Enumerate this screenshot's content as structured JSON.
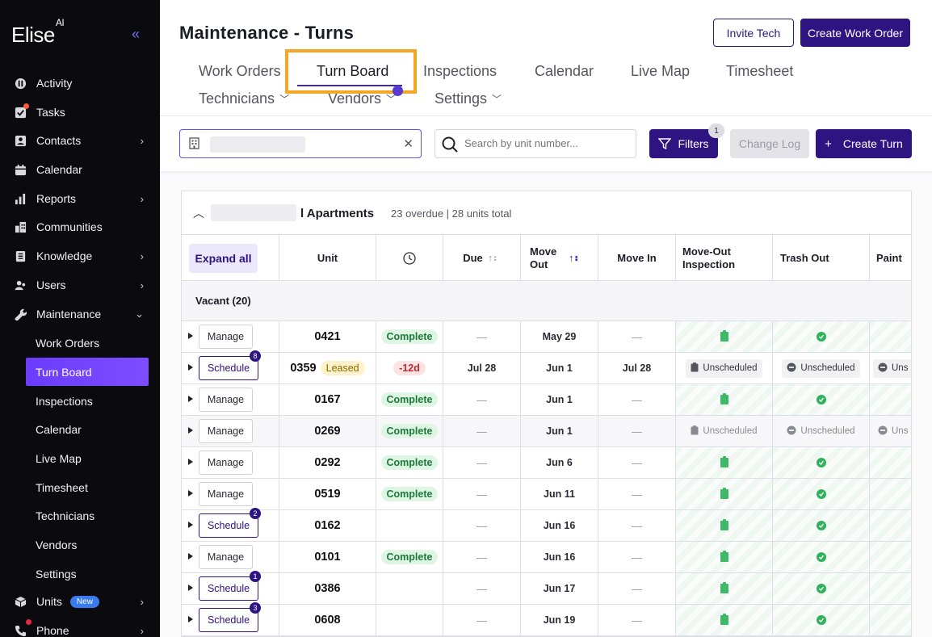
{
  "brand": {
    "name": "Elise",
    "suffix": "AI"
  },
  "sidebar": {
    "items": [
      {
        "label": "Activity",
        "icon": "activity-icon",
        "chevron": false
      },
      {
        "label": "Tasks",
        "icon": "tasks-icon",
        "chevron": false,
        "dot": true
      },
      {
        "label": "Contacts",
        "icon": "contacts-icon",
        "chevron": true
      },
      {
        "label": "Calendar",
        "icon": "calendar-icon",
        "chevron": false
      },
      {
        "label": "Reports",
        "icon": "reports-icon",
        "chevron": true
      },
      {
        "label": "Communities",
        "icon": "communities-icon",
        "chevron": false
      },
      {
        "label": "Knowledge",
        "icon": "knowledge-icon",
        "chevron": true
      },
      {
        "label": "Users",
        "icon": "users-icon",
        "chevron": true
      },
      {
        "label": "Maintenance",
        "icon": "wrench-icon",
        "chevron": "down"
      }
    ],
    "maintenance_sub": [
      "Work Orders",
      "Turn Board",
      "Inspections",
      "Calendar",
      "Live Map",
      "Timesheet",
      "Technicians",
      "Vendors",
      "Settings"
    ],
    "active_sub": "Turn Board",
    "units": {
      "label": "Units",
      "badge": "New"
    },
    "phone": {
      "label": "Phone"
    }
  },
  "header": {
    "title": "Maintenance - Turns",
    "invite_label": "Invite Tech",
    "create_wo_label": "Create Work Order"
  },
  "tabs": {
    "row1": [
      "Work Orders",
      "Turn Board",
      "Inspections",
      "Calendar",
      "Live Map",
      "Timesheet"
    ],
    "row2": [
      "Technicians",
      "Vendors",
      "Settings"
    ],
    "active": "Turn Board"
  },
  "toolbar": {
    "search_placeholder": "Search by unit number...",
    "filters_label": "Filters",
    "filters_count": "1",
    "changelog_label": "Change Log",
    "create_turn_label": "Create Turn"
  },
  "group": {
    "name": "l Apartments",
    "summary": "23 overdue | 28 units total"
  },
  "table": {
    "expand_label": "Expand all",
    "columns": {
      "unit": "Unit",
      "due": "Due",
      "move_out": "Move Out",
      "move_in": "Move In",
      "moveout_insp": "Move-Out Inspection",
      "trash": "Trash Out",
      "paint": "Paint"
    },
    "section": "Vacant (20)",
    "rows": [
      {
        "action": "Manage",
        "unit": "0421",
        "status": "Complete",
        "due": "—",
        "move_out": "May 29",
        "move_in": "—",
        "tasks": "done"
      },
      {
        "action": "Schedule",
        "badge": "8",
        "unit": "0359",
        "leased": "Leased",
        "status": "-12d",
        "due": "Jul 28",
        "move_out": "Jun 1",
        "move_in": "Jul 28",
        "tasks": "unscheduled"
      },
      {
        "action": "Manage",
        "unit": "0167",
        "status": "Complete",
        "due": "—",
        "move_out": "Jun 1",
        "move_in": "—",
        "tasks": "done"
      },
      {
        "action": "Manage",
        "unit": "0269",
        "status": "Complete",
        "due": "—",
        "move_out": "Jun 1",
        "move_in": "—",
        "tasks": "unscheduled-gray"
      },
      {
        "action": "Manage",
        "unit": "0292",
        "status": "Complete",
        "due": "—",
        "move_out": "Jun 6",
        "move_in": "—",
        "tasks": "done"
      },
      {
        "action": "Manage",
        "unit": "0519",
        "status": "Complete",
        "due": "—",
        "move_out": "Jun 11",
        "move_in": "—",
        "tasks": "done"
      },
      {
        "action": "Schedule",
        "badge": "2",
        "unit": "0162",
        "status": "",
        "due": "—",
        "move_out": "Jun 16",
        "move_in": "—",
        "tasks": "done"
      },
      {
        "action": "Manage",
        "unit": "0101",
        "status": "Complete",
        "due": "—",
        "move_out": "Jun 16",
        "move_in": "—",
        "tasks": "done"
      },
      {
        "action": "Schedule",
        "badge": "1",
        "unit": "0386",
        "status": "",
        "due": "—",
        "move_out": "Jun 17",
        "move_in": "—",
        "tasks": "done"
      },
      {
        "action": "Schedule",
        "badge": "3",
        "unit": "0608",
        "status": "",
        "due": "—",
        "move_out": "Jun 19",
        "move_in": "—",
        "tasks": "done"
      }
    ],
    "unscheduled_label": "Unscheduled",
    "paint_cut_label": "Uns"
  },
  "colors": {
    "accent": "#2d1480",
    "highlight": "#f6a623",
    "complete": "#2fb35a"
  }
}
